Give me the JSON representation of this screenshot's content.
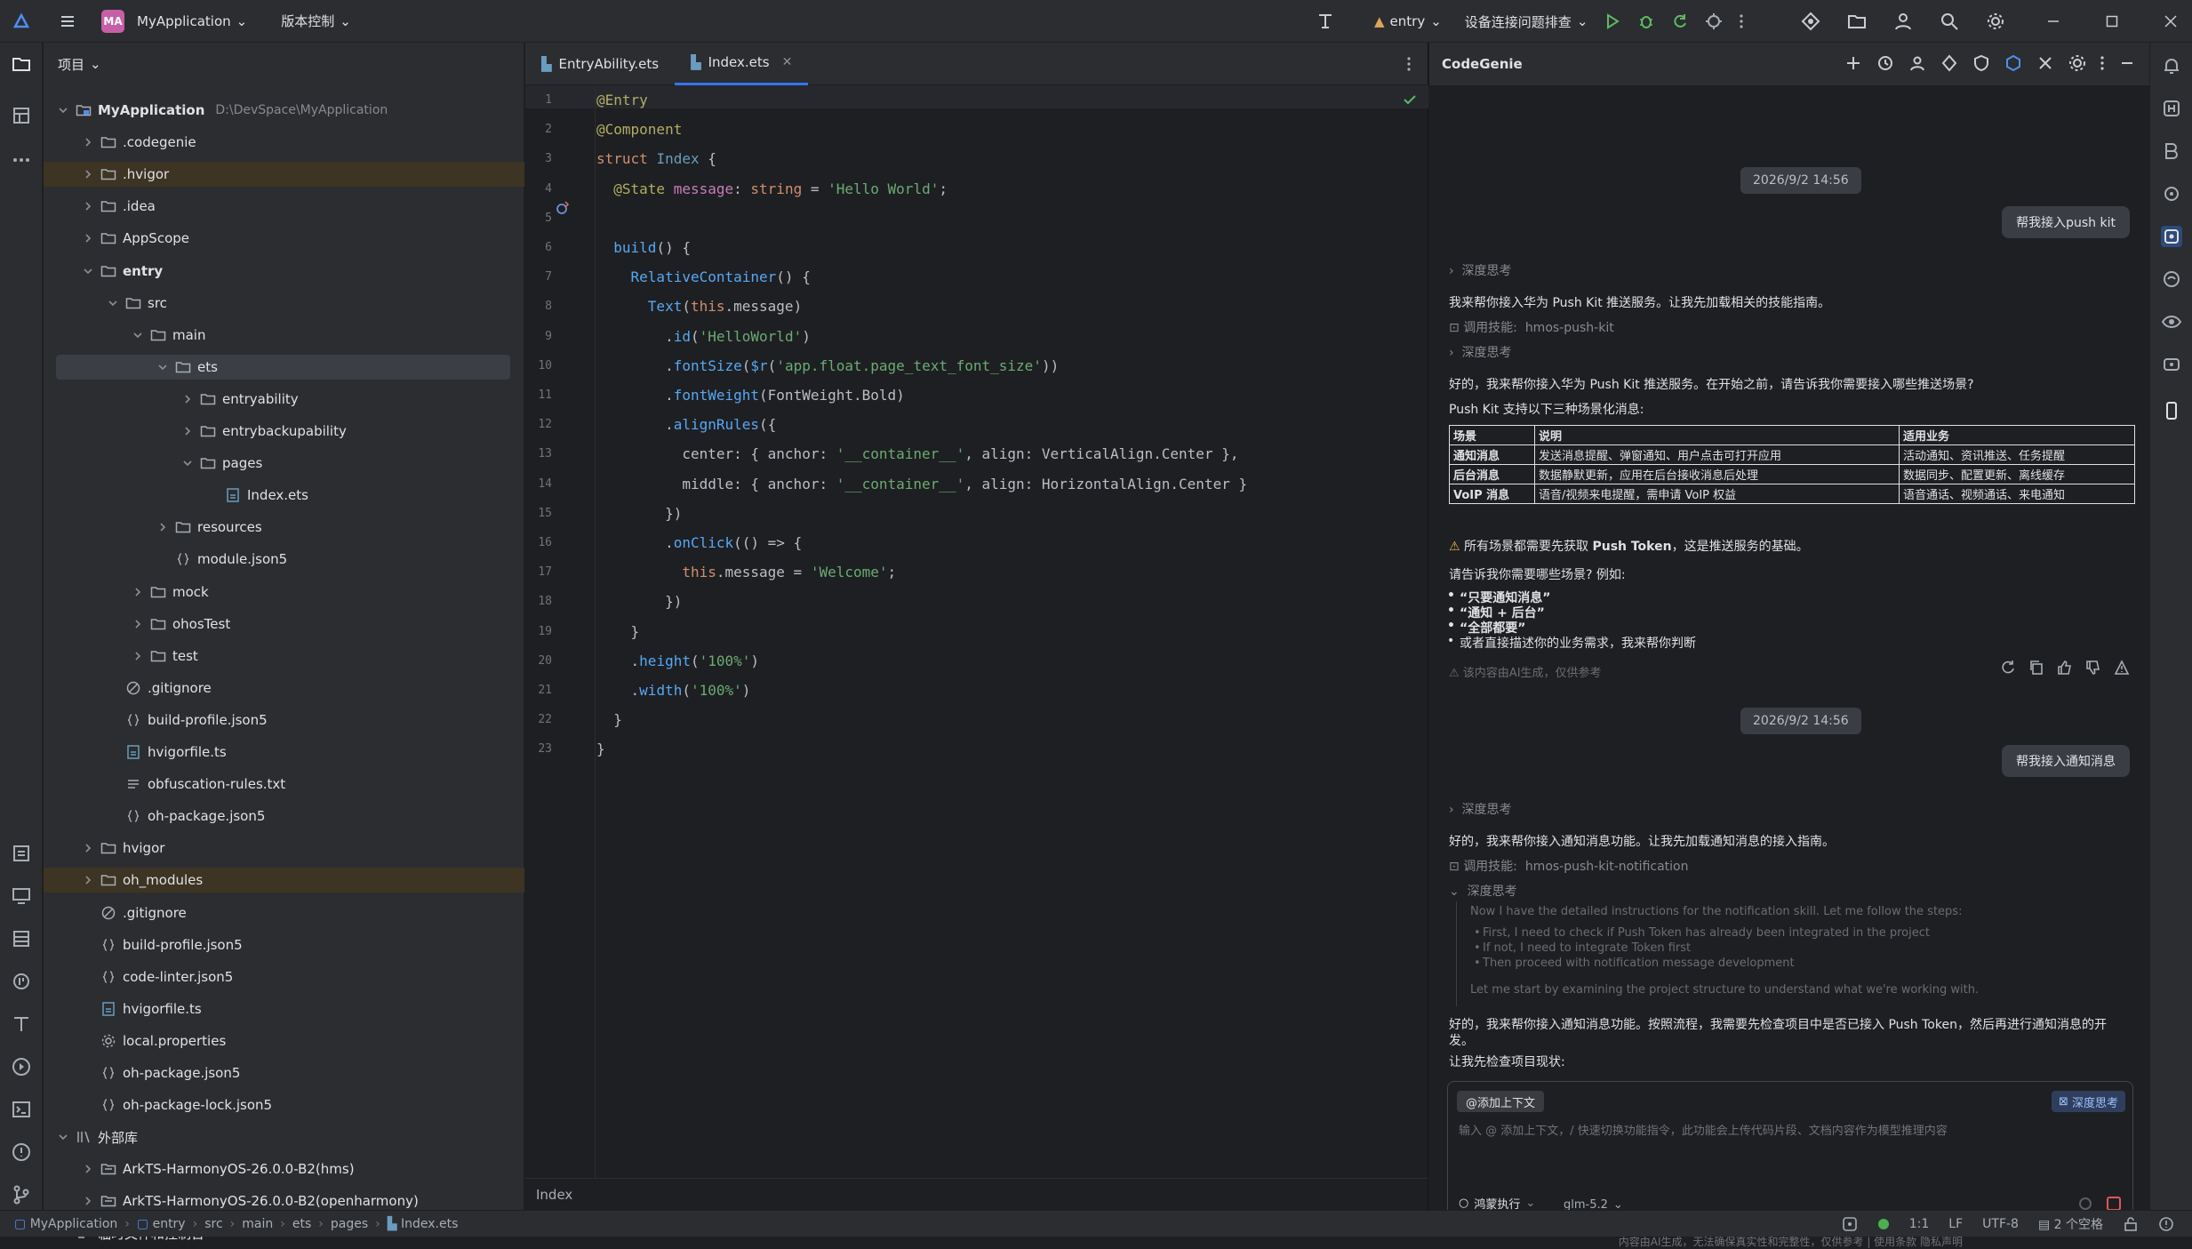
{
  "titlebar": {
    "project_badge": "MA",
    "project_name": "MyApplication",
    "vcs_menu": "版本控制",
    "run_config": "entry",
    "device": "设备连接问题排查"
  },
  "project_panel": {
    "title": "项目",
    "tree": [
      {
        "label": "MyApplication",
        "path": "D:\\DevSpace\\MyApplication",
        "depth": 0,
        "type": "module",
        "open": true,
        "bold": true
      },
      {
        "label": ".codegenie",
        "depth": 1,
        "type": "folder"
      },
      {
        "label": ".hvigor",
        "depth": 1,
        "type": "folder",
        "highlight": true
      },
      {
        "label": ".idea",
        "depth": 1,
        "type": "folder"
      },
      {
        "label": "AppScope",
        "depth": 1,
        "type": "folder"
      },
      {
        "label": "entry",
        "depth": 1,
        "type": "folder",
        "open": true,
        "bold": true
      },
      {
        "label": "src",
        "depth": 2,
        "type": "folder",
        "open": true
      },
      {
        "label": "main",
        "depth": 3,
        "type": "folder",
        "open": true
      },
      {
        "label": "ets",
        "depth": 4,
        "type": "folder",
        "open": true,
        "selected": true
      },
      {
        "label": "entryability",
        "depth": 5,
        "type": "folder"
      },
      {
        "label": "entrybackupability",
        "depth": 5,
        "type": "folder"
      },
      {
        "label": "pages",
        "depth": 5,
        "type": "folder",
        "open": true
      },
      {
        "label": "Index.ets",
        "depth": 6,
        "type": "ets",
        "leaf": true
      },
      {
        "label": "resources",
        "depth": 4,
        "type": "folder"
      },
      {
        "label": "module.json5",
        "depth": 4,
        "type": "json",
        "leaf": true
      },
      {
        "label": "mock",
        "depth": 3,
        "type": "folder"
      },
      {
        "label": "ohosTest",
        "depth": 3,
        "type": "folder"
      },
      {
        "label": "test",
        "depth": 3,
        "type": "folder"
      },
      {
        "label": ".gitignore",
        "depth": 2,
        "type": "ignore",
        "leaf": true
      },
      {
        "label": "build-profile.json5",
        "depth": 2,
        "type": "json",
        "leaf": true
      },
      {
        "label": "hvigorfile.ts",
        "depth": 2,
        "type": "ets",
        "leaf": true
      },
      {
        "label": "obfuscation-rules.txt",
        "depth": 2,
        "type": "text",
        "leaf": true
      },
      {
        "label": "oh-package.json5",
        "depth": 2,
        "type": "json",
        "leaf": true
      },
      {
        "label": "hvigor",
        "depth": 1,
        "type": "folder"
      },
      {
        "label": "oh_modules",
        "depth": 1,
        "type": "folder",
        "highlight": true
      },
      {
        "label": ".gitignore",
        "depth": 1,
        "type": "ignore",
        "leaf": true
      },
      {
        "label": "build-profile.json5",
        "depth": 1,
        "type": "json",
        "leaf": true
      },
      {
        "label": "code-linter.json5",
        "depth": 1,
        "type": "json",
        "leaf": true
      },
      {
        "label": "hvigorfile.ts",
        "depth": 1,
        "type": "ets",
        "leaf": true
      },
      {
        "label": "local.properties",
        "depth": 1,
        "type": "gear",
        "leaf": true
      },
      {
        "label": "oh-package.json5",
        "depth": 1,
        "type": "json",
        "leaf": true
      },
      {
        "label": "oh-package-lock.json5",
        "depth": 1,
        "type": "json",
        "leaf": true
      },
      {
        "label": "外部库",
        "depth": 0,
        "type": "lib",
        "open": true
      },
      {
        "label": "ArkTS-HarmonyOS-26.0.0-B2(hms)",
        "depth": 1,
        "type": "sdk"
      },
      {
        "label": "ArkTS-HarmonyOS-26.0.0-B2(openharmony)",
        "depth": 1,
        "type": "sdk"
      },
      {
        "label": "临时文件和控制台",
        "depth": 0,
        "type": "scratch",
        "leaf": true
      }
    ]
  },
  "editor": {
    "tabs": [
      {
        "label": "EntryAbility.ets",
        "active": false
      },
      {
        "label": "Index.ets",
        "active": true
      }
    ],
    "footer": "Index",
    "lines": [
      [
        [
          "deco",
          "@Entry"
        ]
      ],
      [
        [
          "deco",
          "@Component"
        ]
      ],
      [
        [
          "kw",
          "struct "
        ],
        [
          "ty",
          "Index "
        ],
        [
          "pl",
          "{"
        ]
      ],
      [
        [
          "pl",
          "  "
        ],
        [
          "deco",
          "@State "
        ],
        [
          "prop",
          "message"
        ],
        [
          "pl",
          ": "
        ],
        [
          "kw",
          "string "
        ],
        [
          "pl",
          "= "
        ],
        [
          "str",
          "'Hello World'"
        ],
        [
          "pl",
          ";"
        ]
      ],
      [],
      [
        [
          "pl",
          "  "
        ],
        [
          "fn",
          "build"
        ],
        [
          "pl",
          "() {"
        ]
      ],
      [
        [
          "pl",
          "    "
        ],
        [
          "fn",
          "RelativeContainer"
        ],
        [
          "pl",
          "() {"
        ]
      ],
      [
        [
          "pl",
          "      "
        ],
        [
          "fn",
          "Text"
        ],
        [
          "pl",
          "("
        ],
        [
          "kw",
          "this"
        ],
        [
          "pl",
          ".message)"
        ]
      ],
      [
        [
          "pl",
          "        ."
        ],
        [
          "fn",
          "id"
        ],
        [
          "pl",
          "("
        ],
        [
          "str",
          "'HelloWorld'"
        ],
        [
          "pl",
          ")"
        ]
      ],
      [
        [
          "pl",
          "        ."
        ],
        [
          "fn",
          "fontSize"
        ],
        [
          "pl",
          "("
        ],
        [
          "fn",
          "$r"
        ],
        [
          "pl",
          "("
        ],
        [
          "str",
          "'app.float.page_text_font_size'"
        ],
        [
          "pl",
          "))"
        ]
      ],
      [
        [
          "pl",
          "        ."
        ],
        [
          "fn",
          "fontWeight"
        ],
        [
          "pl",
          "(FontWeight.Bold)"
        ]
      ],
      [
        [
          "pl",
          "        ."
        ],
        [
          "fn",
          "alignRules"
        ],
        [
          "pl",
          "({"
        ]
      ],
      [
        [
          "pl",
          "          center: { anchor: "
        ],
        [
          "str",
          "'__container__'"
        ],
        [
          "pl",
          ", align: VerticalAlign.Center },"
        ]
      ],
      [
        [
          "pl",
          "          middle: { anchor: "
        ],
        [
          "str",
          "'__container__'"
        ],
        [
          "pl",
          ", align: HorizontalAlign.Center }"
        ]
      ],
      [
        [
          "pl",
          "        })"
        ]
      ],
      [
        [
          "pl",
          "        ."
        ],
        [
          "fn",
          "onClick"
        ],
        [
          "pl",
          "(() => {"
        ]
      ],
      [
        [
          "pl",
          "          "
        ],
        [
          "kw",
          "this"
        ],
        [
          "pl",
          ".message = "
        ],
        [
          "str",
          "'Welcome'"
        ],
        [
          "pl",
          ";"
        ]
      ],
      [
        [
          "pl",
          "        })"
        ]
      ],
      [
        [
          "pl",
          "    }"
        ]
      ],
      [
        [
          "pl",
          "    ."
        ],
        [
          "fn",
          "height"
        ],
        [
          "pl",
          "("
        ],
        [
          "str",
          "'100%'"
        ],
        [
          "pl",
          ")"
        ]
      ],
      [
        [
          "pl",
          "    ."
        ],
        [
          "fn",
          "width"
        ],
        [
          "pl",
          "("
        ],
        [
          "str",
          "'100%'"
        ],
        [
          "pl",
          ")"
        ]
      ],
      [
        [
          "pl",
          "  }"
        ]
      ],
      [
        [
          "pl",
          "}"
        ]
      ]
    ]
  },
  "codegenie": {
    "title": "CodeGenie",
    "ts1": "2026/9/2 14:56",
    "user1": "帮我接入push kit",
    "think_label": "深度思考",
    "reply1_intro": "我来帮你接入华为 Push Kit 推送服务。让我先加载相关的技能指南。",
    "skill_label": "调用技能:",
    "skill1": "hmos-push-kit",
    "reply1_ask": "好的，我来帮你接入华为 Push Kit 推送服务。在开始之前，请告诉我你需要接入哪些推送场景?",
    "reply1_support": "Push Kit 支持以下三种场景化消息:",
    "table_headers": [
      "场景",
      "说明",
      "适用业务"
    ],
    "table_rows": [
      [
        "通知消息",
        "发送消息提醒、弹窗通知、用户点击可打开应用",
        "活动通知、资讯推送、任务提醒"
      ],
      [
        "后台消息",
        "数据静默更新，应用在后台接收消息后处理",
        "数据同步、配置更新、离线缓存"
      ],
      [
        "VoIP 消息",
        "语音/视频来电提醒，需申请 VoIP 权益",
        "语音通话、视频通话、来电通知"
      ]
    ],
    "warn_note_pre": "所有场景都需要先获取 ",
    "warn_note_bold": "Push Token",
    "warn_note_post": "，这是推送服务的基础。",
    "ask_scene": "请告诉我你需要哪些场景? 例如:",
    "bullets": [
      "“只要通知消息”",
      "“通知 + 后台”",
      "“全部都要”",
      "或者直接描述你的业务需求，我来帮你判断"
    ],
    "ai_disclaimer": "该内容由AI生成，仅供参考",
    "ts2": "2026/9/2 14:56",
    "user2": "帮我接入通知消息",
    "reply2_intro": "好的，我来帮你接入通知消息功能。让我先加载通知消息的接入指南。",
    "skill2": "hmos-push-kit-notification",
    "thought_text": "Now I have the detailed instructions for the notification skill. Let me follow the steps:",
    "thought_bullets": [
      "First, I need to check if Push Token has already been integrated in the project",
      "If not, I need to integrate Token first",
      "Then proceed with notification message development"
    ],
    "thought_tail": "Let me start by examining the project structure to understand what we're working with.",
    "reply2_body1": "好的，我来帮你接入通知消息功能。按照流程，我需要先检查项目中是否已接入 Push Token，然后再进行通知消息的开",
    "reply2_body2": "发。",
    "reply2_check": "让我先检查项目现状:",
    "add_context": "@添加上下文",
    "deep_think_btn": "深度思考",
    "input_placeholder": "输入 @ 添加上下文，/ 快速切换功能指令，此功能会上传代码片段、文档内容作为模型推理内容",
    "mode_label": "鸿蒙执行",
    "model": "glm-5.2",
    "footer_disclaimer": "内容由AI生成，无法确保真实性和完整性，仅供参考 | 使用条款  隐私声明"
  },
  "statusbar": {
    "crumbs": [
      "MyApplication",
      "entry",
      "src",
      "main",
      "ets",
      "pages",
      "Index.ets"
    ],
    "position": "1:1",
    "line_sep": "LF",
    "encoding": "UTF-8",
    "indent": "2 个空格"
  },
  "colors": {
    "accent": "#3574f0",
    "highlight_folder": "#3e3423",
    "selected_row": "#3b3e45"
  }
}
